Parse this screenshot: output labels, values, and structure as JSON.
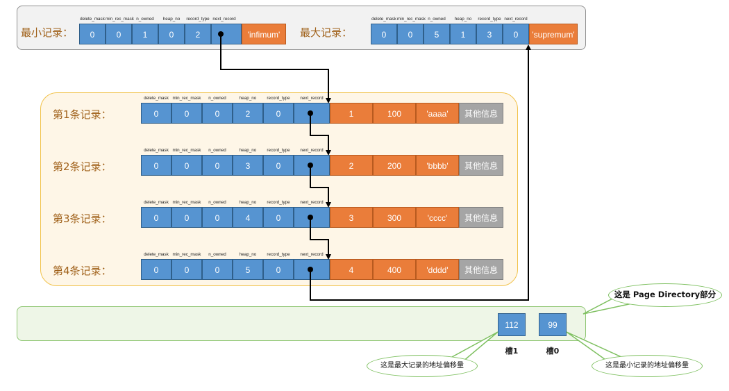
{
  "infimum_record": {
    "label": "最小记录：",
    "headers": [
      "delete_mask",
      "min_rec_mask",
      "n_owned",
      "heap_no",
      "record_type",
      "next_record"
    ],
    "values": [
      "0",
      "0",
      "1",
      "0",
      "2",
      ""
    ],
    "data": "'infimum'"
  },
  "supremum_record": {
    "label": "最大记录：",
    "headers": [
      "delete_mask",
      "min_rec_mask",
      "n_owned",
      "heap_no",
      "record_type",
      "next_record"
    ],
    "values": [
      "0",
      "0",
      "5",
      "1",
      "3",
      "0"
    ],
    "data": "'supremum'"
  },
  "records": [
    {
      "label": "第1条记录：",
      "values": [
        "0",
        "0",
        "0",
        "2",
        "0",
        ""
      ],
      "data": [
        "1",
        "100",
        "'aaaa'"
      ],
      "extra": "其他信息"
    },
    {
      "label": "第2条记录：",
      "values": [
        "0",
        "0",
        "0",
        "3",
        "0",
        ""
      ],
      "data": [
        "2",
        "200",
        "'bbbb'"
      ],
      "extra": "其他信息"
    },
    {
      "label": "第3条记录：",
      "values": [
        "0",
        "0",
        "0",
        "4",
        "0",
        ""
      ],
      "data": [
        "3",
        "300",
        "'cccc'"
      ],
      "extra": "其他信息"
    },
    {
      "label": "第4条记录：",
      "values": [
        "0",
        "0",
        "0",
        "5",
        "0",
        ""
      ],
      "data": [
        "4",
        "400",
        "'dddd'"
      ],
      "extra": "其他信息"
    }
  ],
  "record_headers": [
    "delete_mask",
    "min_rec_mask",
    "n_owned",
    "heap_no",
    "record_type",
    "next_record"
  ],
  "page_directory": {
    "callout": "这是 Page Directory部分",
    "slots": [
      {
        "value": "112",
        "label": "槽1",
        "note": "这是最大记录的地址偏移量"
      },
      {
        "value": "99",
        "label": "槽0",
        "note": "这是最小记录的地址偏移量"
      }
    ]
  },
  "colors": {
    "header_field": "#5694d1",
    "data_field": "#ea7d3a",
    "other_info": "#a5a5a5",
    "label_text": "#a0611a",
    "records_panel_border": "#f1c24a",
    "directory_panel_border": "#8dc571"
  }
}
